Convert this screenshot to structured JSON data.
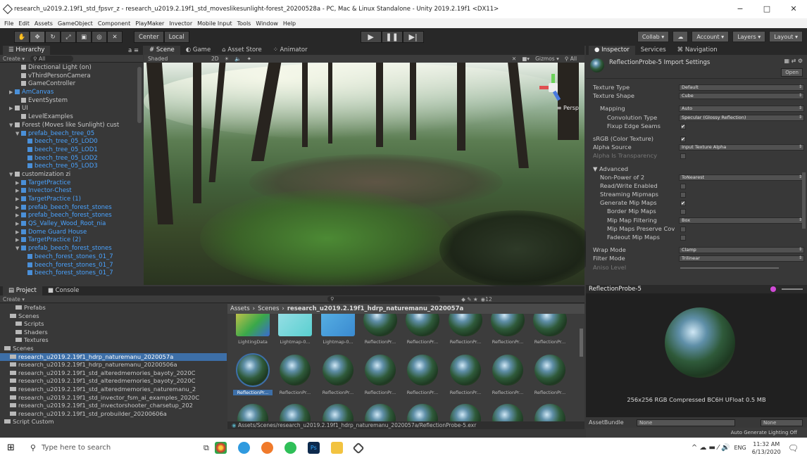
{
  "window": {
    "title": "research_u2019.2.19f1_std_fpsvr_z - research_u2019.2.19f1_std_moveslikesunlight-forest_20200528a - PC, Mac & Linux Standalone - Unity 2019.2.19f1 <DX11>",
    "minimize": "−",
    "maximize": "□",
    "close": "✕"
  },
  "menu": [
    "File",
    "Edit",
    "Assets",
    "GameObject",
    "Component",
    "PlayMaker",
    "Invector",
    "Mobile Input",
    "Tools",
    "Window",
    "Help"
  ],
  "toolbar": {
    "pivot": "Center",
    "space": "Local",
    "collab": "Collab ▾",
    "account": "Account",
    "layers": "Layers",
    "layout": "Layout"
  },
  "hierarchy": {
    "tab": "Hierarchy",
    "create": "Create ▾",
    "search": "All",
    "items": [
      {
        "label": "Directional Light (on)",
        "indent": 2,
        "type": "normal",
        "arrow": ""
      },
      {
        "label": "vThirdPersonCamera",
        "indent": 2,
        "type": "normal",
        "arrow": ""
      },
      {
        "label": "GameController",
        "indent": 2,
        "type": "normal",
        "arrow": ""
      },
      {
        "label": "AmCanvas",
        "indent": 1,
        "type": "blue",
        "arrow": "▶"
      },
      {
        "label": "EventSystem",
        "indent": 2,
        "type": "normal",
        "arrow": ""
      },
      {
        "label": "UI",
        "indent": 1,
        "type": "normal",
        "arrow": "▶"
      },
      {
        "label": "LevelExamples",
        "indent": 2,
        "type": "normal",
        "arrow": ""
      },
      {
        "label": "Forest (Moves like Sunlight) cust",
        "indent": 1,
        "type": "normal",
        "arrow": "▼"
      },
      {
        "label": "prefab_beech_tree_05",
        "indent": 2,
        "type": "blue",
        "arrow": "▼"
      },
      {
        "label": "beech_tree_05_LOD0",
        "indent": 3,
        "type": "blue",
        "arrow": ""
      },
      {
        "label": "beech_tree_05_LOD1",
        "indent": 3,
        "type": "blue",
        "arrow": ""
      },
      {
        "label": "beech_tree_05_LOD2",
        "indent": 3,
        "type": "blue",
        "arrow": ""
      },
      {
        "label": "beech_tree_05_LOD3",
        "indent": 3,
        "type": "blue",
        "arrow": ""
      },
      {
        "label": "customization zi",
        "indent": 1,
        "type": "normal",
        "arrow": "▼"
      },
      {
        "label": "TargetPractice",
        "indent": 2,
        "type": "blue",
        "arrow": "▶"
      },
      {
        "label": "Invector-Chest",
        "indent": 2,
        "type": "blue",
        "arrow": "▶"
      },
      {
        "label": "TargetPractice (1)",
        "indent": 2,
        "type": "blue",
        "arrow": "▶"
      },
      {
        "label": "prefab_beech_forest_stones",
        "indent": 2,
        "type": "blue",
        "arrow": "▶"
      },
      {
        "label": "prefab_beech_forest_stones",
        "indent": 2,
        "type": "blue",
        "arrow": "▶"
      },
      {
        "label": "QS_Valley_Wood_Root_nia",
        "indent": 2,
        "type": "blue",
        "arrow": "▶"
      },
      {
        "label": "Dome Guard House",
        "indent": 2,
        "type": "blue",
        "arrow": "▶"
      },
      {
        "label": "TargetPractice (2)",
        "indent": 2,
        "type": "blue",
        "arrow": "▶"
      },
      {
        "label": "prefab_beech_forest_stones",
        "indent": 2,
        "type": "blue",
        "arrow": "▼"
      },
      {
        "label": "beech_forest_stones_01_7",
        "indent": 3,
        "type": "blue",
        "arrow": ""
      },
      {
        "label": "beech_forest_stones_01_7",
        "indent": 3,
        "type": "blue",
        "arrow": ""
      },
      {
        "label": "beech_forest_stones_01_7",
        "indent": 3,
        "type": "blue",
        "arrow": ""
      }
    ]
  },
  "scene": {
    "tabs": [
      "Scene",
      "Game",
      "Asset Store",
      "Animator"
    ],
    "shading": "Shaded",
    "mode2d": "2D",
    "gizmos": "Gizmos ▾",
    "search": "All",
    "persp": "Persp"
  },
  "inspector": {
    "tabs": [
      "Inspector",
      "Services",
      "Navigation"
    ],
    "title": "ReflectionProbe-5 Import Settings",
    "open": "Open",
    "rows": [
      {
        "label": "Texture Type",
        "value": "Default",
        "kind": "drop",
        "indent": 0,
        "dim": false
      },
      {
        "label": "Texture Shape",
        "value": "Cube",
        "kind": "drop",
        "indent": 0,
        "dim": false
      },
      {
        "label": "",
        "value": "",
        "kind": "gap",
        "indent": 0,
        "dim": false
      },
      {
        "label": "Mapping",
        "value": "Auto",
        "kind": "drop",
        "indent": 1,
        "dim": false
      },
      {
        "label": "Convolution Type",
        "value": "Specular (Glossy Reflection)",
        "kind": "drop",
        "indent": 2,
        "dim": false
      },
      {
        "label": "Fixup Edge Seams",
        "value": "✔",
        "kind": "check",
        "indent": 2,
        "dim": false
      },
      {
        "label": "",
        "value": "",
        "kind": "gap",
        "indent": 0,
        "dim": false
      },
      {
        "label": "sRGB (Color Texture)",
        "value": "✔",
        "kind": "check",
        "indent": 0,
        "dim": false
      },
      {
        "label": "Alpha Source",
        "value": "Input Texture Alpha",
        "kind": "drop",
        "indent": 0,
        "dim": false
      },
      {
        "label": "Alpha Is Transparency",
        "value": "",
        "kind": "check",
        "indent": 0,
        "dim": true
      },
      {
        "label": "",
        "value": "",
        "kind": "gap",
        "indent": 0,
        "dim": false
      },
      {
        "label": "▼ Advanced",
        "value": "",
        "kind": "head",
        "indent": 0,
        "dim": false
      },
      {
        "label": "Non-Power of 2",
        "value": "ToNearest",
        "kind": "drop",
        "indent": 1,
        "dim": false
      },
      {
        "label": "Read/Write Enabled",
        "value": "",
        "kind": "check",
        "indent": 1,
        "dim": false
      },
      {
        "label": "Streaming Mipmaps",
        "value": "",
        "kind": "check",
        "indent": 1,
        "dim": false
      },
      {
        "label": "Generate Mip Maps",
        "value": "✔",
        "kind": "check",
        "indent": 1,
        "dim": false
      },
      {
        "label": "Border Mip Maps",
        "value": "",
        "kind": "check",
        "indent": 2,
        "dim": false
      },
      {
        "label": "Mip Map Filtering",
        "value": "Box",
        "kind": "drop",
        "indent": 2,
        "dim": false
      },
      {
        "label": "Mip Maps Preserve Cov",
        "value": "",
        "kind": "check",
        "indent": 2,
        "dim": false
      },
      {
        "label": "Fadeout Mip Maps",
        "value": "",
        "kind": "check",
        "indent": 2,
        "dim": false
      },
      {
        "label": "",
        "value": "",
        "kind": "gap",
        "indent": 0,
        "dim": false
      },
      {
        "label": "Wrap Mode",
        "value": "Clamp",
        "kind": "drop",
        "indent": 0,
        "dim": false
      },
      {
        "label": "Filter Mode",
        "value": "Trilinear",
        "kind": "drop",
        "indent": 0,
        "dim": false
      },
      {
        "label": "Aniso Level",
        "value": "",
        "kind": "slider",
        "indent": 0,
        "dim": true
      }
    ],
    "preview_title": "ReflectionProbe-5",
    "preview_info": "256x256  RGB Compressed BC6H UFloat  0.5 MB",
    "assetbundle_label": "AssetBundle",
    "assetbundle_value": "None",
    "assetbundle_variant": "None",
    "status": "Auto Generate Lighting Off"
  },
  "project": {
    "tabs": [
      "Project",
      "Console"
    ],
    "create": "Create ▾",
    "count": "12",
    "breadcrumb": [
      "Assets",
      "Scenes",
      "research_u2019.2.19f1_hdrp_naturemanu_2020057a"
    ],
    "tree": [
      {
        "label": "Prefabs",
        "indent": 2,
        "sel": false
      },
      {
        "label": "Scenes",
        "indent": 1,
        "sel": false
      },
      {
        "label": "Scripts",
        "indent": 2,
        "sel": false
      },
      {
        "label": "Shaders",
        "indent": 2,
        "sel": false
      },
      {
        "label": "Textures",
        "indent": 2,
        "sel": false
      },
      {
        "label": "Scenes",
        "indent": 0,
        "sel": false
      },
      {
        "label": "research_u2019.2.19f1_hdrp_naturemanu_2020057a",
        "indent": 1,
        "sel": true
      },
      {
        "label": "research_u2019.2.19f1_hdrp_naturemanu_20200506a",
        "indent": 1,
        "sel": false
      },
      {
        "label": "research_u2019.2.19f1_std_alteredmemories_bayoty_2020C",
        "indent": 1,
        "sel": false
      },
      {
        "label": "research_u2019.2.19f1_std_alteredmemories_bayoty_2020C",
        "indent": 1,
        "sel": false
      },
      {
        "label": "research_u2019.2.19f1_std_alteredmemories_naturemanu_2",
        "indent": 1,
        "sel": false
      },
      {
        "label": "research_u2019.2.19f1_std_invector_fsm_ai_examples_2020C",
        "indent": 1,
        "sel": false
      },
      {
        "label": "research_u2019.2.19f1_std_invectorshooter_charsetup_202",
        "indent": 1,
        "sel": false
      },
      {
        "label": "research_u2019.2.19f1_std_probuilder_20200606a",
        "indent": 1,
        "sel": false
      },
      {
        "label": "Script Custom",
        "indent": 0,
        "sel": false
      }
    ],
    "row1_labels": [
      "LightingData",
      "Lightmap-0...",
      "Lightmap-0...",
      "ReflectionPr...",
      "ReflectionPr...",
      "ReflectionPr...",
      "ReflectionPr...",
      "ReflectionPr..."
    ],
    "row2_labels": [
      "ReflectionPr...",
      "ReflectionPr...",
      "ReflectionPr...",
      "ReflectionPr...",
      "ReflectionPr...",
      "ReflectionPr...",
      "ReflectionPr...",
      "ReflectionPr..."
    ],
    "footer_path": "Assets/Scenes/research_u2019.2.19f1_hdrp_naturemanu_2020057a/ReflectionProbe-5.exr"
  },
  "taskbar": {
    "search_placeholder": "Type here to search",
    "lang": "ENG",
    "time": "11:32 AM",
    "date": "6/13/2020"
  }
}
